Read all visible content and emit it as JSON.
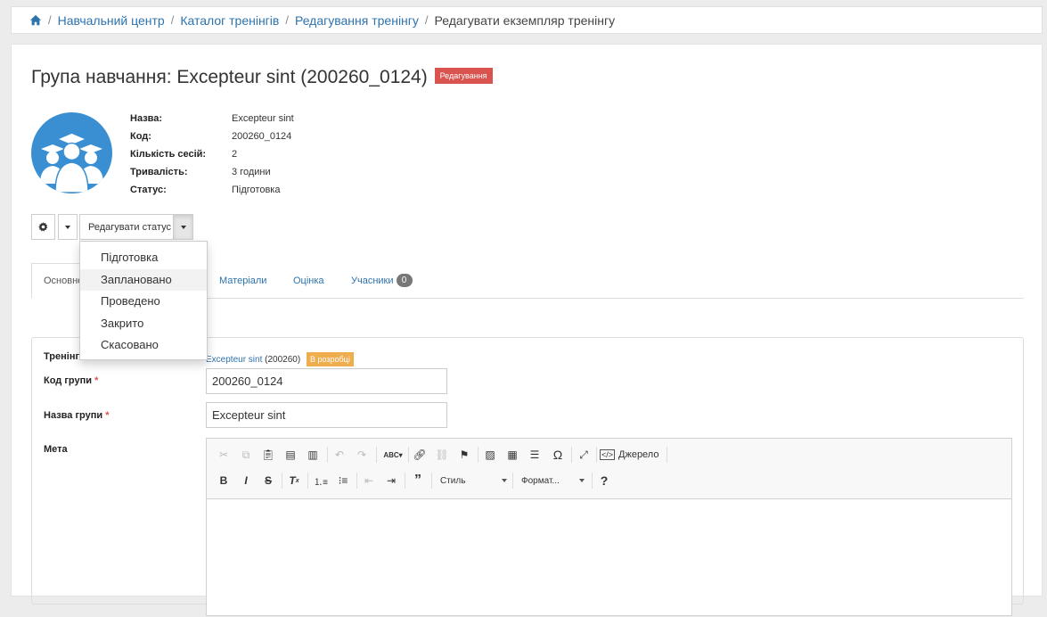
{
  "breadcrumb": {
    "items": [
      "Навчальний центр",
      "Каталог тренінгів",
      "Редагування тренінгу"
    ],
    "current": "Редагувати екземпляр тренінгу"
  },
  "header": {
    "title": "Група навчання: Excepteur sint (200260_0124)",
    "badge": "Редагування"
  },
  "info": [
    {
      "label": "Назва:",
      "value": "Excepteur sint"
    },
    {
      "label": "Код:",
      "value": "200260_0124"
    },
    {
      "label": "Кількість сесій:",
      "value": "2"
    },
    {
      "label": "Тривалість:",
      "value": "3 години"
    },
    {
      "label": "Статус:",
      "value": "Підготовка"
    }
  ],
  "actions": {
    "status_button": "Редагувати статус"
  },
  "status_menu": [
    "Підготовка",
    "Заплановано",
    "Проведено",
    "Закрито",
    "Скасовано"
  ],
  "tabs": [
    {
      "label": "Основне"
    },
    {
      "label": "Матеріали"
    },
    {
      "label": "Оцінка"
    },
    {
      "label": "Учасники",
      "count": "0"
    }
  ],
  "form": {
    "training_label": "Тренінг",
    "training_link": "Excepteur sint",
    "training_code": "(200260)",
    "training_badge": "В розробці",
    "code_label": "Код групи",
    "code_value": "200260_0124",
    "name_label": "Назва групи",
    "name_value": "Excepteur sint",
    "meta_label": "Мета",
    "required_mark": "*"
  },
  "editor": {
    "source_label": "Джерело",
    "style_combo": "Стиль",
    "format_combo": "Формат..."
  },
  "colors": {
    "link": "#2d73ad",
    "danger": "#d9534f",
    "warning": "#f0ad4e",
    "avatar": "#3a8fd3"
  }
}
